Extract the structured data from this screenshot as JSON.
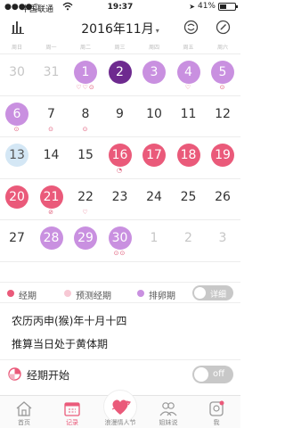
{
  "status_bar": {
    "carrier": "中国联通",
    "time": "19:37",
    "battery": "41%",
    "battery_level": 0.41
  },
  "header": {
    "month_title": "2016年11月",
    "caret": "▾",
    "left_icon": "bar-chart-icon",
    "right_icons": [
      "sync-icon",
      "edit-icon"
    ]
  },
  "weekdays": [
    "周日",
    "周一",
    "周二",
    "周三",
    "周四",
    "周五",
    "周六"
  ],
  "calendar": {
    "weeks": [
      [
        {
          "d": "30",
          "t": "other",
          "m": ""
        },
        {
          "d": "31",
          "t": "other",
          "m": ""
        },
        {
          "d": "1",
          "t": "ovu",
          "m": "♡♡⊙"
        },
        {
          "d": "2",
          "t": "sel",
          "m": ""
        },
        {
          "d": "3",
          "t": "ovu",
          "m": ""
        },
        {
          "d": "4",
          "t": "ovu",
          "m": "♡"
        },
        {
          "d": "5",
          "t": "ovu",
          "m": "⊙"
        }
      ],
      [
        {
          "d": "6",
          "t": "ovu",
          "m": "⊙"
        },
        {
          "d": "7",
          "t": "",
          "m": "⊙"
        },
        {
          "d": "8",
          "t": "",
          "m": "⊙"
        },
        {
          "d": "9",
          "t": "",
          "m": ""
        },
        {
          "d": "10",
          "t": "",
          "m": ""
        },
        {
          "d": "11",
          "t": "",
          "m": ""
        },
        {
          "d": "12",
          "t": "",
          "m": ""
        }
      ],
      [
        {
          "d": "13",
          "t": "today",
          "m": ""
        },
        {
          "d": "14",
          "t": "",
          "m": ""
        },
        {
          "d": "15",
          "t": "",
          "m": ""
        },
        {
          "d": "16",
          "t": "per",
          "m": "◔"
        },
        {
          "d": "17",
          "t": "per",
          "m": ""
        },
        {
          "d": "18",
          "t": "per",
          "m": ""
        },
        {
          "d": "19",
          "t": "per",
          "m": ""
        }
      ],
      [
        {
          "d": "20",
          "t": "per",
          "m": ""
        },
        {
          "d": "21",
          "t": "per",
          "m": "⊘"
        },
        {
          "d": "22",
          "t": "",
          "m": "♡"
        },
        {
          "d": "23",
          "t": "",
          "m": ""
        },
        {
          "d": "24",
          "t": "",
          "m": ""
        },
        {
          "d": "25",
          "t": "",
          "m": ""
        },
        {
          "d": "26",
          "t": "",
          "m": ""
        }
      ],
      [
        {
          "d": "27",
          "t": "",
          "m": ""
        },
        {
          "d": "28",
          "t": "ovu",
          "m": ""
        },
        {
          "d": "29",
          "t": "ovu",
          "m": ""
        },
        {
          "d": "30",
          "t": "ovu",
          "m": "⊙⊙"
        },
        {
          "d": "1",
          "t": "other",
          "m": ""
        },
        {
          "d": "2",
          "t": "other",
          "m": ""
        },
        {
          "d": "3",
          "t": "other",
          "m": ""
        }
      ]
    ]
  },
  "legend": {
    "period": "经期",
    "predicted": "预测经期",
    "ovulation": "排卵期",
    "detail_toggle": "详细"
  },
  "info": {
    "lunar": "农历丙申(猴)年十月十四",
    "phase": "推算当日处于黄体期"
  },
  "period_start": {
    "label": "经期开始",
    "toggle": "off"
  },
  "tabs": [
    "首页",
    "记录",
    "浪漫情人节",
    "姐妹说",
    "我"
  ],
  "colors": {
    "period": "#ea5a7a",
    "predicted": "#f7c8d4",
    "ovulation": "#c990e0",
    "selected": "#6e2a8f",
    "today": "#d4e7f5"
  }
}
